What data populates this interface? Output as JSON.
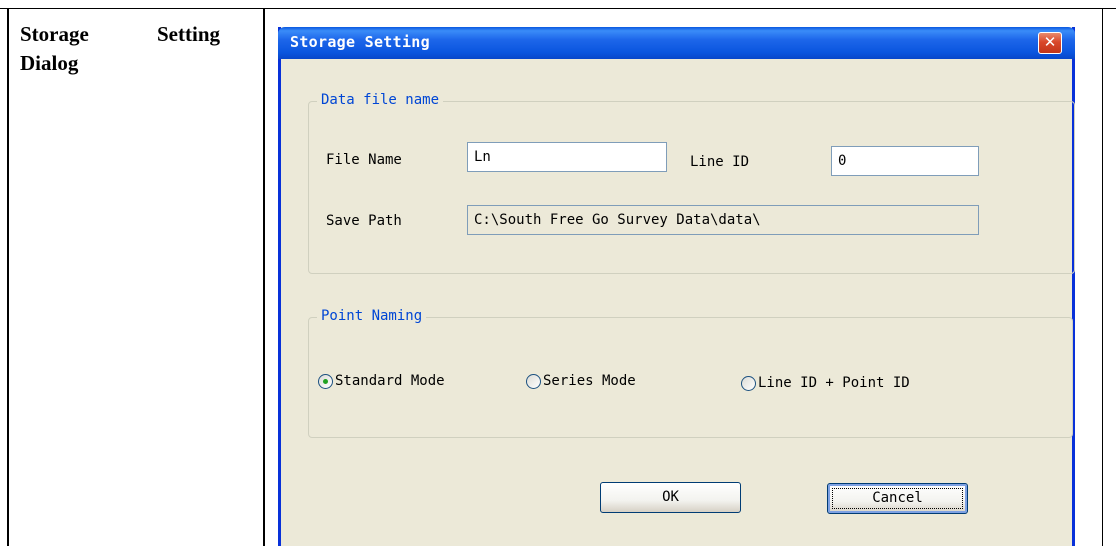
{
  "doc": {
    "label_line1_word1": "Storage",
    "label_line1_word2": "Setting",
    "label_line2": "Dialog"
  },
  "dialog": {
    "title": "Storage Setting",
    "close_symbol": "✕",
    "data_file_group": {
      "legend": "Data file name",
      "file_name_label": "File Name",
      "file_name_value": "Ln",
      "line_id_label": "Line ID",
      "line_id_value": "0",
      "save_path_label": "Save Path",
      "save_path_value": "C:\\South Free Go Survey Data\\data\\"
    },
    "point_naming_group": {
      "legend": "Point Naming",
      "options": [
        {
          "label": "Standard Mode",
          "checked": true
        },
        {
          "label": "Series Mode",
          "checked": false
        },
        {
          "label": "Line ID + Point ID",
          "checked": false
        }
      ]
    },
    "buttons": {
      "ok": "OK",
      "cancel": "Cancel"
    }
  },
  "colors": {
    "title_bar": "#0a55de",
    "dialog_bg": "#ece9d8",
    "legend_text": "#0046d5",
    "close_button": "#d9482b"
  },
  "icons": {
    "close": "close-icon"
  }
}
